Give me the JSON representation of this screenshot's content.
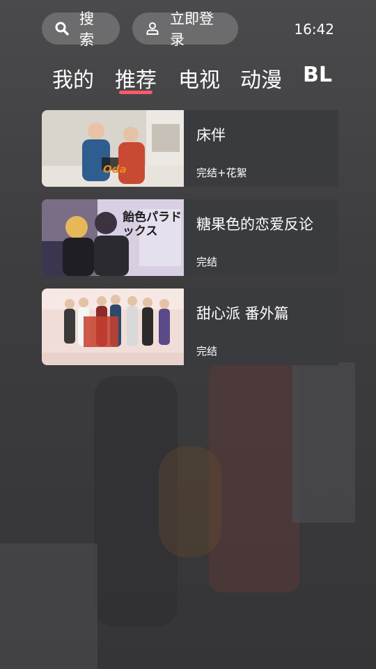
{
  "header": {
    "search_label": "搜索",
    "login_label": "立即登录",
    "time": "16:42"
  },
  "tabs": [
    {
      "label": "我的",
      "active": false
    },
    {
      "label": "推荐",
      "active": true
    },
    {
      "label": "电视",
      "active": false
    },
    {
      "label": "动漫",
      "active": false
    },
    {
      "label": "BL",
      "active": false
    }
  ],
  "accent_color": "#ff5a6a",
  "items": [
    {
      "title": "床伴",
      "status": "完结+花絮",
      "thumb_caption": "Oda"
    },
    {
      "title": "糖果色的恋爱反论",
      "status": "完结",
      "thumb_caption": "飴色パラドックス"
    },
    {
      "title": "甜心派 番外篇",
      "status": "完结",
      "thumb_caption": ""
    }
  ],
  "icons": {
    "search": "search-icon",
    "user": "user-icon"
  }
}
